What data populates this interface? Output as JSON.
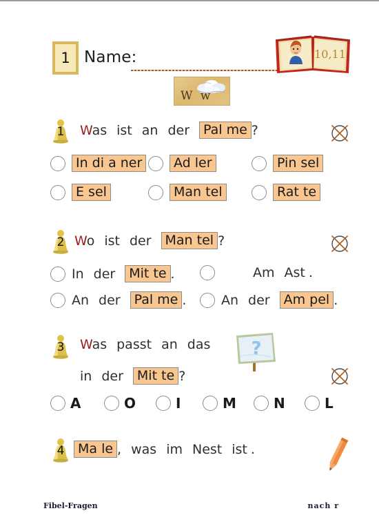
{
  "header": {
    "sheet_number": "1",
    "name_label": "Name:",
    "name_value": "",
    "book_page_numbers": "10,11",
    "letter_card": {
      "letters": "W w",
      "picture": "cloud-icon"
    }
  },
  "questions": [
    {
      "number": "1",
      "prompt_words": [
        "Was",
        "ist",
        "an",
        "der"
      ],
      "prompt_chip": "Pal me",
      "prompt_end": "?",
      "marker": "circle-cross-icon",
      "option_rows": [
        [
          {
            "chip": "In di a ner"
          },
          {
            "chip": "Ad ler"
          },
          {
            "chip": "Pin sel"
          }
        ],
        [
          {
            "chip": "E sel"
          },
          {
            "chip": "Man tel"
          },
          {
            "chip": "Rat te"
          }
        ]
      ]
    },
    {
      "number": "2",
      "prompt_words": [
        "Wo",
        "ist",
        "der"
      ],
      "prompt_chip": "Man tel",
      "prompt_end": "?",
      "marker": "circle-cross-icon",
      "option_rows": [
        [
          {
            "pre": [
              "In",
              "der"
            ],
            "chip": "Mit te",
            "post": "."
          },
          {
            "pre": [
              "Am",
              "Ast"
            ],
            "chip": "",
            "post": "."
          }
        ],
        [
          {
            "pre": [
              "An",
              "der"
            ],
            "chip": "Pal me",
            "post": "."
          },
          {
            "pre": [
              "An",
              "der"
            ],
            "chip": "Am pel",
            "post": "."
          }
        ]
      ]
    },
    {
      "number": "3",
      "prompt_words": [
        "Was",
        "passt",
        "an",
        "das"
      ],
      "prompt_picture": "question-sign-icon",
      "prompt_line2_words": [
        "in",
        "der"
      ],
      "prompt_chip": "Mit te",
      "prompt_end": "?",
      "marker": "circle-cross-icon",
      "letters": [
        "A",
        "O",
        "I",
        "M",
        "N",
        "L"
      ]
    },
    {
      "number": "4",
      "prompt_chip": "Ma le",
      "prompt_words": [
        ",",
        "was",
        "im",
        "Nest",
        "ist",
        "."
      ],
      "marker": "pencil-icon"
    }
  ],
  "footer": {
    "left": "Fibel-Fragen",
    "right": "nach   r"
  },
  "colors": {
    "chip_fill": "#f9c690",
    "chip_border": "#8a8a8a",
    "first_letter": "#9c1c1c",
    "text": "#2f2f2f",
    "badge_fill": "#f7eab8",
    "badge_border": "#d9b760",
    "cross": "#a9611f",
    "name_line": "#b4561e"
  }
}
